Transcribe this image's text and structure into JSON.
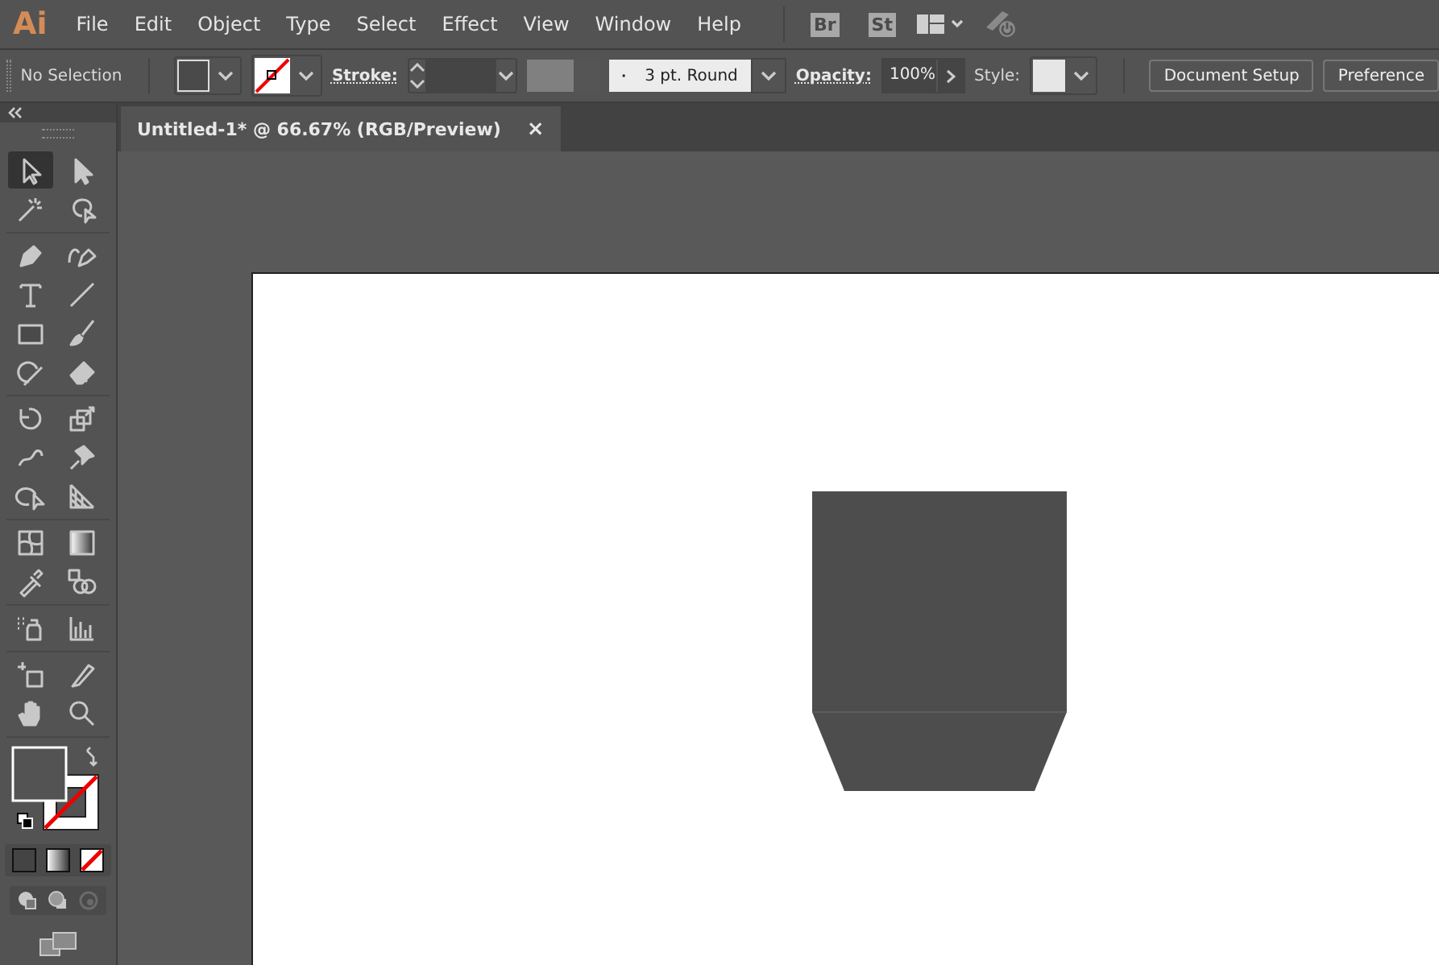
{
  "app_logo": "Ai",
  "menu": [
    "File",
    "Edit",
    "Object",
    "Type",
    "Select",
    "Effect",
    "View",
    "Window",
    "Help"
  ],
  "bridge_badges": [
    "Br",
    "St"
  ],
  "control_bar": {
    "selection_label": "No Selection",
    "stroke_label": "Stroke:",
    "brush": "3 pt. Round",
    "opacity_label": "Opacity:",
    "opacity": "100%",
    "style_label": "Style:",
    "buttons": [
      "Document Setup",
      "Preference"
    ]
  },
  "document_tab": {
    "title": "Untitled-1* @ 66.67% (RGB/Preview)",
    "close": "×"
  },
  "tool_groups": [
    [
      {
        "kind": "selection",
        "selected": true
      },
      {
        "kind": "direct-selection",
        "selected": false
      },
      {
        "kind": "magic-wand",
        "selected": false
      },
      {
        "kind": "lasso",
        "selected": false
      }
    ],
    [
      {
        "kind": "pen",
        "selected": false
      },
      {
        "kind": "curvature",
        "selected": false
      },
      {
        "kind": "type",
        "selected": false
      },
      {
        "kind": "line",
        "selected": false
      },
      {
        "kind": "rectangle",
        "selected": false
      },
      {
        "kind": "paintbrush",
        "selected": false
      },
      {
        "kind": "shaper",
        "selected": false
      },
      {
        "kind": "eraser",
        "selected": false
      }
    ],
    [
      {
        "kind": "rotate",
        "selected": false
      },
      {
        "kind": "scale",
        "selected": false
      },
      {
        "kind": "puppet-warp",
        "selected": false
      },
      {
        "kind": "pin",
        "selected": false
      },
      {
        "kind": "shape-builder",
        "selected": false
      },
      {
        "kind": "perspective",
        "selected": false
      }
    ],
    [
      {
        "kind": "mesh",
        "selected": false
      },
      {
        "kind": "gradient",
        "selected": false
      },
      {
        "kind": "eyedropper",
        "selected": false
      },
      {
        "kind": "blend",
        "selected": false
      }
    ],
    [
      {
        "kind": "symbol-sprayer",
        "selected": false
      },
      {
        "kind": "graph",
        "selected": false
      }
    ],
    [
      {
        "kind": "artboard",
        "selected": false
      },
      {
        "kind": "slice",
        "selected": false
      },
      {
        "kind": "hand",
        "selected": false
      },
      {
        "kind": "zoom",
        "selected": false
      }
    ]
  ]
}
